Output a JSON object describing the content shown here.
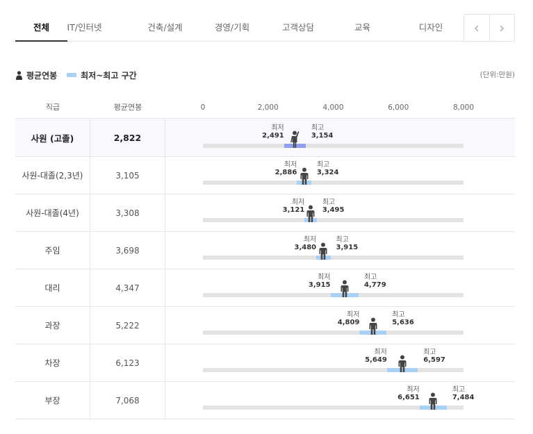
{
  "tabs": [
    {
      "label": "전체",
      "active": true
    },
    {
      "label": "IT/인터넷",
      "active": false
    },
    {
      "label": "건축/설계",
      "active": false
    },
    {
      "label": "경영/기획",
      "active": false
    },
    {
      "label": "고객상담",
      "active": false
    },
    {
      "label": "교육",
      "active": false
    },
    {
      "label": "디자인",
      "active": false
    }
  ],
  "nav": {
    "prev_icon": "chevron-left-icon",
    "next_icon": "chevron-right-icon",
    "prev": "‹",
    "next": "›"
  },
  "legend": {
    "avg_label": "평균연봉",
    "range_label": "최저~최고 구간",
    "unit": "(단위:만원)"
  },
  "colors": {
    "range": "#a9d0f5",
    "range_highlight": "#8f9ef0",
    "track": "#e3e3e3",
    "person": "#444444"
  },
  "table": {
    "col_title": "직급",
    "col_avg": "평균연봉",
    "min_caption": "최저",
    "max_caption": "최고"
  },
  "chart_data": {
    "type": "bar",
    "x_ticks": [
      "0",
      "2,000",
      "4,000",
      "6,000",
      "8,000"
    ],
    "xlim": [
      0,
      8000
    ],
    "rows": [
      {
        "title": "사원 (고졸)",
        "avg": 2822,
        "avg_label": "2,822",
        "min": 2491,
        "min_label": "2,491",
        "max": 3154,
        "max_label": "3,154",
        "highlight": true
      },
      {
        "title": "사원-대졸(2,3년)",
        "avg": 3105,
        "avg_label": "3,105",
        "min": 2886,
        "min_label": "2,886",
        "max": 3324,
        "max_label": "3,324",
        "highlight": false
      },
      {
        "title": "사원-대졸(4년)",
        "avg": 3308,
        "avg_label": "3,308",
        "min": 3121,
        "min_label": "3,121",
        "max": 3495,
        "max_label": "3,495",
        "highlight": false
      },
      {
        "title": "주임",
        "avg": 3698,
        "avg_label": "3,698",
        "min": 3480,
        "min_label": "3,480",
        "max": 3915,
        "max_label": "3,915",
        "highlight": false
      },
      {
        "title": "대리",
        "avg": 4347,
        "avg_label": "4,347",
        "min": 3915,
        "min_label": "3,915",
        "max": 4779,
        "max_label": "4,779",
        "highlight": false
      },
      {
        "title": "과장",
        "avg": 5222,
        "avg_label": "5,222",
        "min": 4809,
        "min_label": "4,809",
        "max": 5636,
        "max_label": "5,636",
        "highlight": false
      },
      {
        "title": "차장",
        "avg": 6123,
        "avg_label": "6,123",
        "min": 5649,
        "min_label": "5,649",
        "max": 6597,
        "max_label": "6,597",
        "highlight": false
      },
      {
        "title": "부장",
        "avg": 7068,
        "avg_label": "7,068",
        "min": 6651,
        "min_label": "6,651",
        "max": 7484,
        "max_label": "7,484",
        "highlight": false
      }
    ]
  }
}
